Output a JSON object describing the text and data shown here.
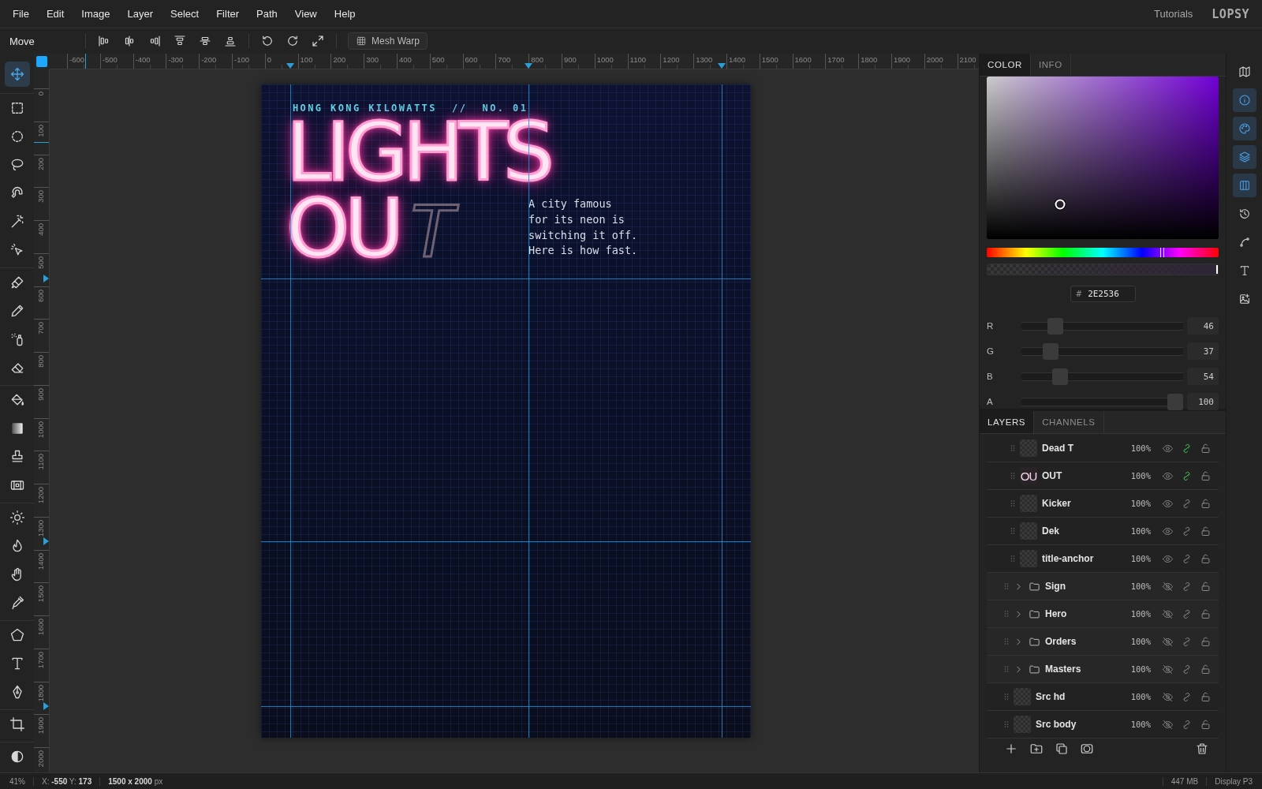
{
  "menu": {
    "items": [
      "File",
      "Edit",
      "Image",
      "Layer",
      "Select",
      "Filter",
      "Path",
      "View",
      "Help"
    ],
    "tutorials": "Tutorials",
    "logo": "LOPSY"
  },
  "options_bar": {
    "tool_name": "Move",
    "mesh_warp": "Mesh Warp"
  },
  "rulers": {
    "horizontal": [
      "-600",
      "-500",
      "-400",
      "-300",
      "-200",
      "-100",
      "0",
      "100",
      "200",
      "300",
      "400",
      "500",
      "600",
      "700",
      "800",
      "900",
      "1000",
      "1100",
      "1200",
      "1300",
      "1400",
      "1500",
      "1600",
      "1700",
      "1800",
      "1900",
      "2000",
      "2100"
    ],
    "vertical": [
      "0",
      "100",
      "200",
      "300",
      "400",
      "500",
      "600",
      "700",
      "800",
      "900",
      "1000",
      "1100",
      "1200",
      "1300",
      "1400",
      "1500",
      "1600",
      "1700",
      "1800",
      "1900",
      "2000"
    ]
  },
  "tools": [
    [
      {
        "selected": true
      }
    ],
    [
      {
        "selected": false
      },
      {
        "selected": false
      },
      {
        "selected": false
      },
      {
        "selected": false
      },
      {
        "selected": false
      },
      {
        "selected": false
      }
    ],
    [
      {
        "selected": false
      },
      {
        "selected": false
      },
      {
        "selected": false
      },
      {
        "selected": false
      }
    ],
    [
      {
        "selected": false
      },
      {
        "selected": false
      },
      {
        "selected": false
      },
      {
        "selected": false
      }
    ],
    [
      {
        "selected": false
      },
      {
        "selected": false
      },
      {
        "selected": false
      },
      {
        "selected": false
      }
    ],
    [
      {
        "selected": false
      },
      {
        "selected": false
      },
      {
        "selected": false
      }
    ],
    [
      {
        "selected": false
      }
    ],
    [
      {
        "selected": false
      }
    ]
  ],
  "document": {
    "kicker": "HONG KONG KILOWATTS  //  NO. 01",
    "title_lines": [
      "LIGHTS",
      "OU"
    ],
    "dead_letter": "T",
    "dek_lines": [
      "A city famous",
      "for its neon is",
      "switching it off.",
      "Here is how fast."
    ]
  },
  "color_panel": {
    "tabs": [
      {
        "label": "COLOR",
        "selected": true
      },
      {
        "label": "INFO",
        "selected": false
      }
    ],
    "hex_prefix": "#",
    "hex": "2E2536",
    "channels": [
      {
        "label": "R",
        "value": "46",
        "level": 0.18
      },
      {
        "label": "G",
        "value": "37",
        "level": 0.145
      },
      {
        "label": "B",
        "value": "54",
        "level": 0.21
      },
      {
        "label": "A",
        "value": "100",
        "level": 1
      }
    ]
  },
  "side_strip": [
    {
      "selected": false
    },
    {
      "selected": true
    },
    {
      "selected": true
    },
    {
      "selected": true
    },
    {
      "selected": true
    },
    {
      "selected": false
    },
    {
      "selected": false
    },
    {
      "selected": false
    },
    {
      "selected": false
    }
  ],
  "layers_panel": {
    "tabs": [
      {
        "label": "LAYERS",
        "selected": true
      },
      {
        "label": "CHANNELS",
        "selected": false
      }
    ],
    "layers": [
      {
        "children": [
          {
            "kind": "layer",
            "name": "Dead T",
            "opacity": "100%",
            "visible": true,
            "linked": true,
            "locked": false
          },
          {
            "kind": "layer",
            "name": "OUT",
            "thumb_text": "OU",
            "opacity": "100%",
            "visible": true,
            "linked": true,
            "locked": false
          },
          {
            "kind": "layer",
            "name": "Kicker",
            "opacity": "100%",
            "visible": true,
            "linked": false,
            "locked": false
          },
          {
            "kind": "layer",
            "name": "Dek",
            "opacity": "100%",
            "visible": true,
            "linked": false,
            "locked": false
          },
          {
            "kind": "layer",
            "name": "title-anchor",
            "opacity": "100%",
            "visible": true,
            "linked": false,
            "locked": false
          }
        ]
      },
      {
        "kind": "group",
        "name": "Sign",
        "opacity": "100%",
        "visible": false,
        "linked": false,
        "locked": false,
        "expanded": false
      },
      {
        "kind": "group",
        "name": "Hero",
        "opacity": "100%",
        "visible": false,
        "linked": false,
        "locked": false,
        "expanded": false
      },
      {
        "kind": "group",
        "name": "Orders",
        "opacity": "100%",
        "visible": false,
        "linked": false,
        "locked": false,
        "expanded": false
      },
      {
        "kind": "group",
        "name": "Masters",
        "opacity": "100%",
        "visible": false,
        "linked": false,
        "locked": false,
        "expanded": false
      },
      {
        "kind": "layer",
        "name": "Src hd",
        "opacity": "100%",
        "visible": false,
        "linked": false,
        "locked": false
      },
      {
        "kind": "layer",
        "name": "Src body",
        "opacity": "100%",
        "visible": false,
        "linked": false,
        "locked": false
      }
    ]
  },
  "status_bar": {
    "zoom": "41%",
    "cursor": "X: **-550** Y: **173**",
    "size": "**1500 x 2000** px",
    "memory": "447 MB",
    "profile": "Display P3"
  }
}
